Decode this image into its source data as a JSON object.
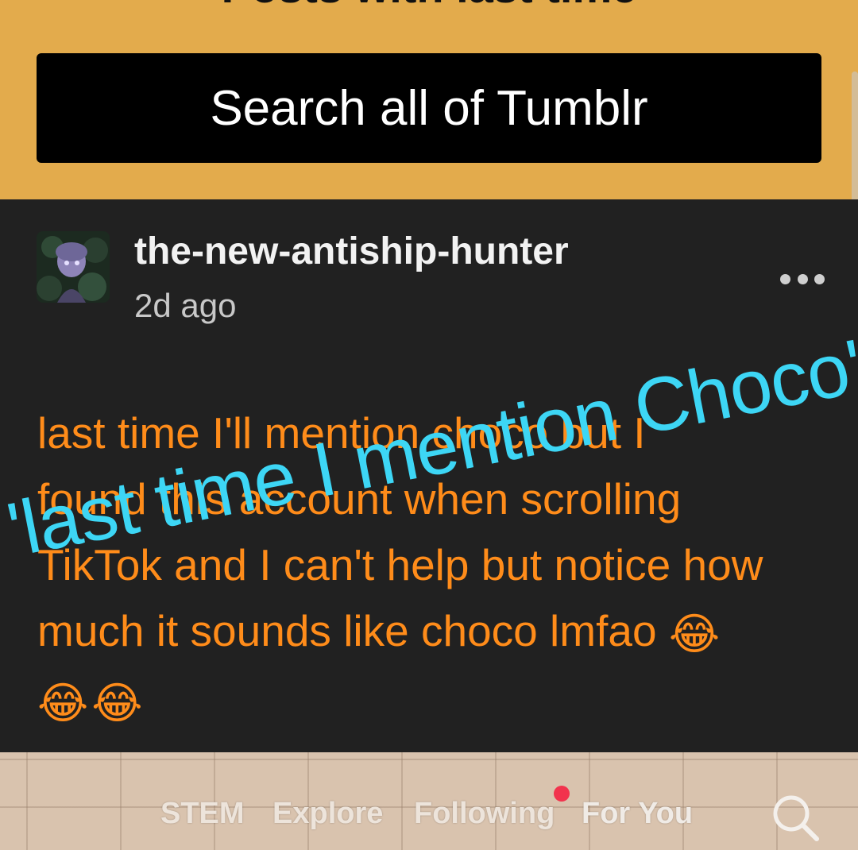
{
  "header": {
    "title": "Posts with last time",
    "search_label": "Search all of Tumblr",
    "accent_color": "#e3ab4c"
  },
  "post": {
    "blog_name": "the-new-antiship-hunter",
    "time_ago": "2d ago",
    "more_icon": "ellipsis-icon",
    "body_lines": [
      "last time I'll mention choco but I",
      "found this account when scrolling",
      "TikTok and I can't help but notice how",
      "much it sounds like choco lmfao"
    ],
    "emoji": "😂",
    "text_color": "#ff8c1a"
  },
  "overlay": {
    "caption": "'last time I mention Choco'",
    "color": "#3dd6f5"
  },
  "bottom_nav": {
    "tabs": [
      "STEM",
      "Explore",
      "Following",
      "For You"
    ],
    "active_tab": "For You",
    "search_icon": "search-icon"
  }
}
